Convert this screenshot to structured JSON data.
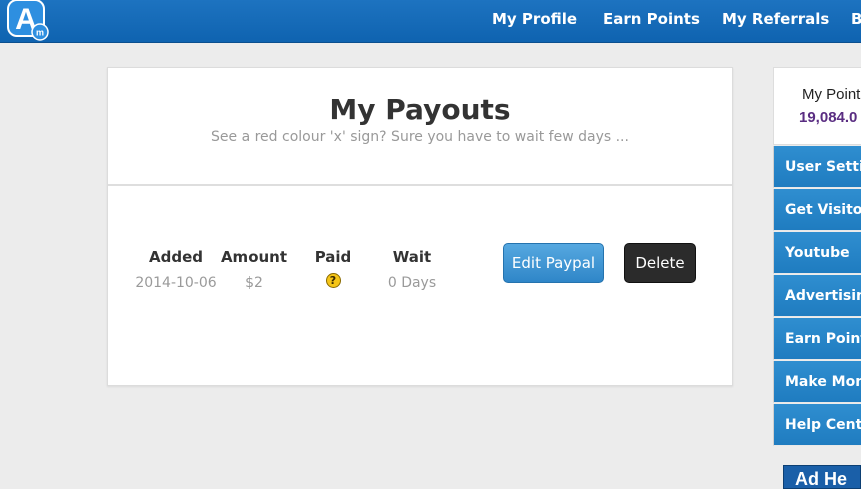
{
  "nav": {
    "items": [
      "My Profile",
      "Earn Points",
      "My Referrals",
      "B"
    ]
  },
  "payouts": {
    "title": "My Payouts",
    "subtitle": "See a red colour 'x' sign? Sure you have to wait few days ...",
    "columns": [
      "Added",
      "Amount",
      "Paid",
      "Wait"
    ],
    "row": {
      "added": "2014-10-06",
      "amount": "$2",
      "paid_icon": "question-mark-icon",
      "wait": "0 Days"
    },
    "edit_label": "Edit Paypal",
    "delete_label": "Delete"
  },
  "sidebar": {
    "points_label": "My Point",
    "points_value": "19,084.0",
    "items": [
      "User Setting",
      "Get Visitors",
      "Youtube",
      "Advertising",
      "Earn Points",
      "Make Mone",
      "Help Center"
    ],
    "ad_text": "Ad He"
  },
  "colors": {
    "nav_bg": "#1d73c0",
    "menu_bg": "#2f8ed0",
    "points_value": "#5a2d82",
    "edit_btn": "#3a90d0",
    "delete_btn": "#2b2b2b"
  }
}
